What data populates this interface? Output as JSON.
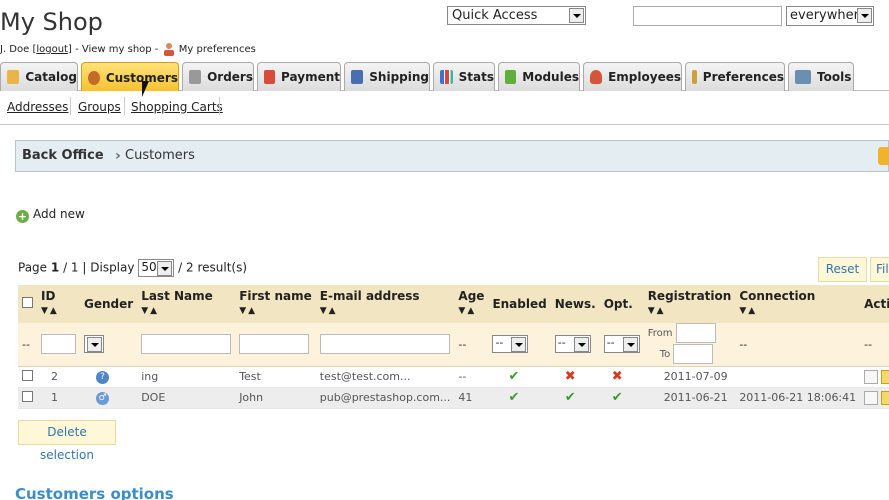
{
  "header": {
    "shop_title": "My Shop",
    "user_prefix": "J. Doe [",
    "logout": "logout",
    "user_mid": "] - ",
    "view_shop": "View my shop",
    "sep": " - ",
    "my_preferences": "My preferences",
    "quick_access": "Quick Access",
    "search_value": "",
    "search_scope": "everywhere"
  },
  "tabs": [
    {
      "label": "Catalog",
      "icon": "folder-icon",
      "color": "#e8b54a"
    },
    {
      "label": "Customers",
      "icon": "user-icon",
      "color": "#c46b2a"
    },
    {
      "label": "Orders",
      "icon": "cart-icon",
      "color": "#888888"
    },
    {
      "label": "Payment",
      "icon": "card-icon",
      "color": "#d84a3a"
    },
    {
      "label": "Shipping",
      "icon": "truck-icon",
      "color": "#4a6fb0"
    },
    {
      "label": "Stats",
      "icon": "bar-chart-icon",
      "color": "#3b74c9"
    },
    {
      "label": "Modules",
      "icon": "puzzle-icon",
      "color": "#5fae3e"
    },
    {
      "label": "Employees",
      "icon": "employee-icon",
      "color": "#d4553b"
    },
    {
      "label": "Preferences",
      "icon": "prefs-icon",
      "color": "#c9a23c"
    },
    {
      "label": "Tools",
      "icon": "wrench-icon",
      "color": "#6b8fb0"
    }
  ],
  "subnav": [
    "Addresses",
    "Groups",
    "Shopping Carts"
  ],
  "breadcrumb": {
    "root": "Back Office",
    "current": "Customers"
  },
  "add_new": "Add new",
  "pager": {
    "page_label": "Page",
    "page": "1",
    "page_sep": "/ 1 | Display",
    "display": "50",
    "results": "/ 2 result(s)"
  },
  "buttons": {
    "reset": "Reset",
    "filter": "Filter",
    "delete_selection": "Delete selection"
  },
  "table": {
    "headers": [
      "ID",
      "Gender",
      "Last Name",
      "First name",
      "E-mail address",
      "Age",
      "Enabled",
      "News.",
      "Opt.",
      "Registration",
      "Connection",
      "Actions"
    ],
    "filters": {
      "dash": "--",
      "from": "From",
      "to": "To"
    },
    "rows": [
      {
        "id": "2",
        "gender": "?",
        "last_name": "ing",
        "first_name": "Test",
        "email": "test@test.com...",
        "age": "--",
        "enabled": true,
        "news": false,
        "opt": false,
        "registration": "2011-07-09",
        "connection": ""
      },
      {
        "id": "1",
        "gender": "♂",
        "last_name": "DOE",
        "first_name": "John",
        "email": "pub@prestashop.com...",
        "age": "41",
        "enabled": true,
        "news": true,
        "opt": true,
        "registration": "2011-06-21",
        "connection": "2011-06-21 18:06:41"
      }
    ]
  },
  "section_title": "Customers options"
}
